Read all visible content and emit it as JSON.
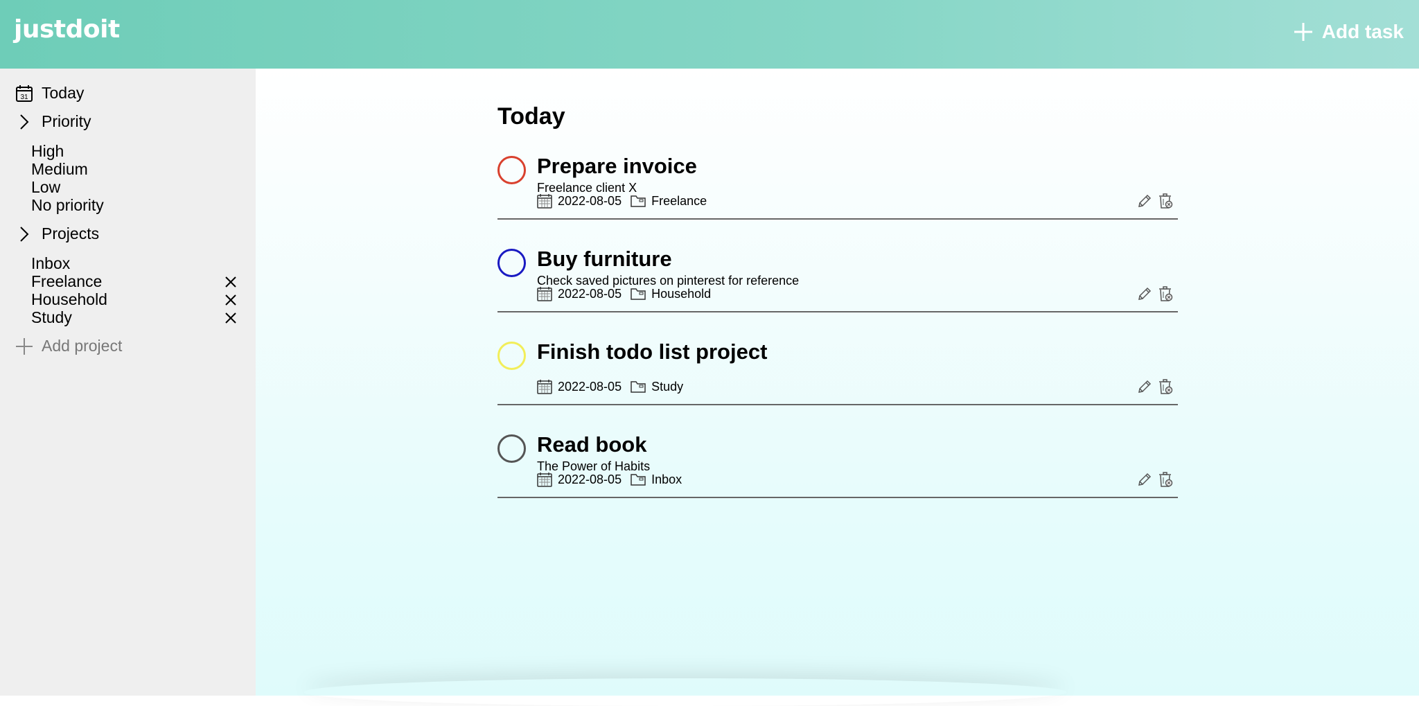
{
  "app": {
    "logo": "justdoit"
  },
  "header": {
    "add_task_label": "Add task",
    "add_icon": "plus-icon"
  },
  "sidebar": {
    "today_label": "Today",
    "today_icon": "calendar-icon",
    "priority_label": "Priority",
    "priority_items": [
      "High",
      "Medium",
      "Low",
      "No priority"
    ],
    "projects_label": "Projects",
    "project_items": [
      {
        "label": "Inbox",
        "removable": false
      },
      {
        "label": "Freelance",
        "removable": true
      },
      {
        "label": "Household",
        "removable": true
      },
      {
        "label": "Study",
        "removable": true
      }
    ],
    "add_project_label": "Add project"
  },
  "main": {
    "title": "Today",
    "tasks": [
      {
        "title": "Prepare invoice",
        "description": "Freelance client X",
        "date": "2022-08-05",
        "project": "Freelance",
        "priority_color": "#d9412e"
      },
      {
        "title": "Buy furniture",
        "description": "Check saved pictures on pinterest for reference",
        "date": "2022-08-05",
        "project": "Household",
        "priority_color": "#1a1ac2"
      },
      {
        "title": "Finish todo list project",
        "description": "",
        "date": "2022-08-05",
        "project": "Study",
        "priority_color": "#f2ee5a"
      },
      {
        "title": "Read book",
        "description": "The Power of Habits",
        "date": "2022-08-05",
        "project": "Inbox",
        "priority_color": "#555555"
      }
    ]
  },
  "colors": {
    "header_gradient_start": "#6ecdb8",
    "header_gradient_end": "#a3dfd6",
    "sidebar_bg": "#efefef"
  }
}
